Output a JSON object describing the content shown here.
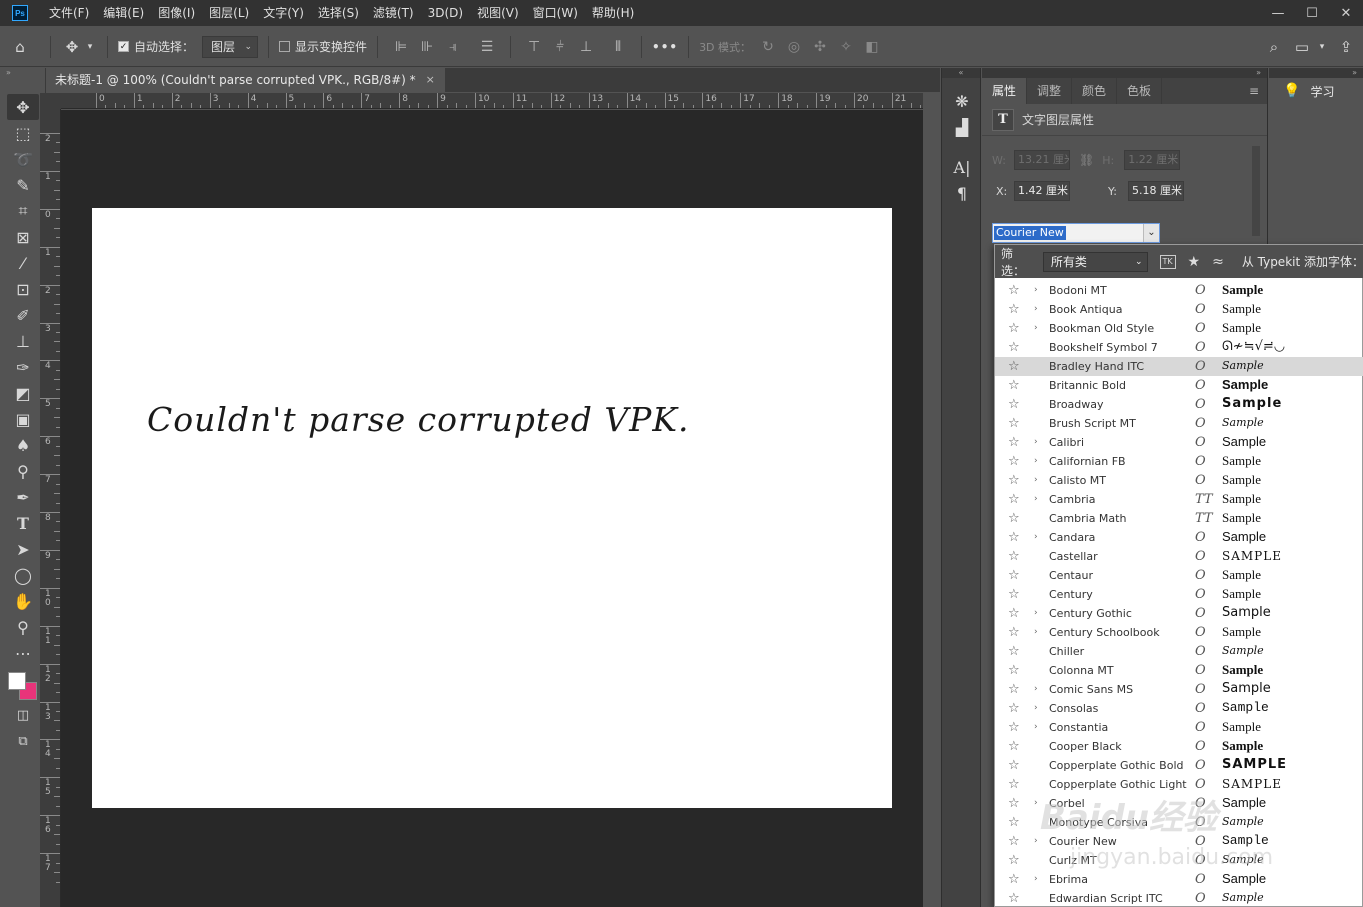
{
  "app": {
    "logo": "Ps",
    "menu": [
      "文件(F)",
      "编辑(E)",
      "图像(I)",
      "图层(L)",
      "文字(Y)",
      "选择(S)",
      "滤镜(T)",
      "3D(D)",
      "视图(V)",
      "窗口(W)",
      "帮助(H)"
    ],
    "window_controls": [
      "—",
      "☐",
      "✕"
    ]
  },
  "options_bar": {
    "auto_select_label": "自动选择：",
    "auto_select_checked": true,
    "auto_select_target": "图层",
    "show_transform_label": "显示变换控件",
    "show_transform_checked": false,
    "more": "•••",
    "mode_3d_label": "3D 模式："
  },
  "document": {
    "tab_title": "未标题-1 @ 100% (Couldn't parse corrupted VPK., RGB/8#) *",
    "tab_close": "×",
    "canvas_text": "Couldn't parse corrupted VPK.",
    "ruler_h": [
      "0",
      "1",
      "2",
      "3",
      "4",
      "5",
      "6",
      "7",
      "8",
      "9",
      "10",
      "11",
      "12",
      "13",
      "14",
      "15",
      "16",
      "17",
      "18",
      "19",
      "20",
      "21"
    ],
    "ruler_v": [
      "2",
      "1",
      "0",
      "1",
      "2",
      "3",
      "4",
      "5",
      "6",
      "7",
      "8",
      "9",
      "10",
      "11",
      "12",
      "13",
      "14",
      "15",
      "16",
      "17"
    ]
  },
  "properties": {
    "tabs": [
      "属性",
      "调整",
      "颜色",
      "色板"
    ],
    "active_tab": 0,
    "menu": "≡",
    "layer_kind_icon": "T",
    "layer_kind": "文字图层属性",
    "w_label": "W:",
    "w_value": "13.21 厘米",
    "h_label": "H:",
    "h_value": "1.22 厘米",
    "x_label": "X:",
    "x_value": "1.42 厘米",
    "y_label": "Y:",
    "y_value": "5.18 厘米",
    "font_value": "Courier New"
  },
  "learn": {
    "title": "学习"
  },
  "font_dropdown": {
    "filter_label": "筛选：",
    "filter_value": "所有类",
    "tk_label": "TK",
    "typekit_label": "从 Typekit 添加字体：",
    "highlighted_index": 4,
    "fonts": [
      {
        "name": "Bodoni MT",
        "expandable": true,
        "type": "O",
        "sample": "Sample",
        "style": "s-serifb"
      },
      {
        "name": "Book Antiqua",
        "expandable": true,
        "type": "O",
        "sample": "Sample",
        "style": "s-serif"
      },
      {
        "name": "Bookman Old Style",
        "expandable": true,
        "type": "O",
        "sample": "Sample",
        "style": "s-serif"
      },
      {
        "name": "Bookshelf Symbol 7",
        "expandable": false,
        "type": "O",
        "sample": "ᘏ≁≒√≓◡",
        "style": "s-dejavu"
      },
      {
        "name": "Bradley Hand ITC",
        "expandable": false,
        "type": "O",
        "sample": "Sample",
        "style": "s-script"
      },
      {
        "name": "Britannic Bold",
        "expandable": false,
        "type": "O",
        "sample": "Sample",
        "style": "s-sansb"
      },
      {
        "name": "Broadway",
        "expandable": false,
        "type": "O",
        "sample": "Sample",
        "style": "s-wide"
      },
      {
        "name": "Brush Script MT",
        "expandable": false,
        "type": "O",
        "sample": "Sample",
        "style": "s-script"
      },
      {
        "name": "Calibri",
        "expandable": true,
        "type": "O",
        "sample": "Sample",
        "style": "s-sans"
      },
      {
        "name": "Californian FB",
        "expandable": true,
        "type": "O",
        "sample": "Sample",
        "style": "s-serif"
      },
      {
        "name": "Calisto MT",
        "expandable": true,
        "type": "O",
        "sample": "Sample",
        "style": "s-serif"
      },
      {
        "name": "Cambria",
        "expandable": true,
        "type": "TT",
        "sample": "Sample",
        "style": "s-serif"
      },
      {
        "name": "Cambria Math",
        "expandable": false,
        "type": "TT",
        "sample": "Sample",
        "style": "s-serif"
      },
      {
        "name": "Candara",
        "expandable": true,
        "type": "O",
        "sample": "Sample",
        "style": "s-sans"
      },
      {
        "name": "Castellar",
        "expandable": false,
        "type": "O",
        "sample": "SAMPLE",
        "style": "s-caps"
      },
      {
        "name": "Centaur",
        "expandable": false,
        "type": "O",
        "sample": "Sample",
        "style": "s-serif"
      },
      {
        "name": "Century",
        "expandable": false,
        "type": "O",
        "sample": "Sample",
        "style": "s-serif"
      },
      {
        "name": "Century Gothic",
        "expandable": true,
        "type": "O",
        "sample": "Sample",
        "style": "s-dejavu"
      },
      {
        "name": "Century Schoolbook",
        "expandable": true,
        "type": "O",
        "sample": "Sample",
        "style": "s-serif"
      },
      {
        "name": "Chiller",
        "expandable": false,
        "type": "O",
        "sample": "Sample",
        "style": "s-script"
      },
      {
        "name": "Colonna MT",
        "expandable": false,
        "type": "O",
        "sample": "Sample",
        "style": "s-serifb"
      },
      {
        "name": "Comic Sans MS",
        "expandable": true,
        "type": "O",
        "sample": "Sample",
        "style": "s-dejavu"
      },
      {
        "name": "Consolas",
        "expandable": true,
        "type": "O",
        "sample": "Sample",
        "style": "s-mono"
      },
      {
        "name": "Constantia",
        "expandable": true,
        "type": "O",
        "sample": "Sample",
        "style": "s-serif"
      },
      {
        "name": "Cooper Black",
        "expandable": false,
        "type": "O",
        "sample": "Sample",
        "style": "s-serifb"
      },
      {
        "name": "Copperplate Gothic Bold",
        "expandable": false,
        "type": "O",
        "sample": "SAMPLE",
        "style": "s-wide"
      },
      {
        "name": "Copperplate Gothic Light",
        "expandable": false,
        "type": "O",
        "sample": "SAMPLE",
        "style": "s-caps"
      },
      {
        "name": "Corbel",
        "expandable": true,
        "type": "O",
        "sample": "Sample",
        "style": "s-sans"
      },
      {
        "name": "Monotype Corsiva",
        "expandable": false,
        "type": "O",
        "sample": "Sample",
        "style": "s-script"
      },
      {
        "name": "Courier New",
        "expandable": true,
        "type": "O",
        "sample": "Sample",
        "style": "s-mono"
      },
      {
        "name": "Curlz MT",
        "expandable": false,
        "type": "O",
        "sample": "Sample",
        "style": "s-script"
      },
      {
        "name": "Ebrima",
        "expandable": true,
        "type": "O",
        "sample": "Sample",
        "style": "s-sans"
      },
      {
        "name": "Edwardian Script ITC",
        "expandable": false,
        "type": "O",
        "sample": "Sample",
        "style": "s-script"
      }
    ]
  },
  "watermark": {
    "brand": "Baidu经验",
    "url": "jingyan.baidu.com"
  },
  "colors": {
    "foreground": "#ffffff",
    "background": "#e8347a",
    "selection": "#2d6bc9"
  }
}
